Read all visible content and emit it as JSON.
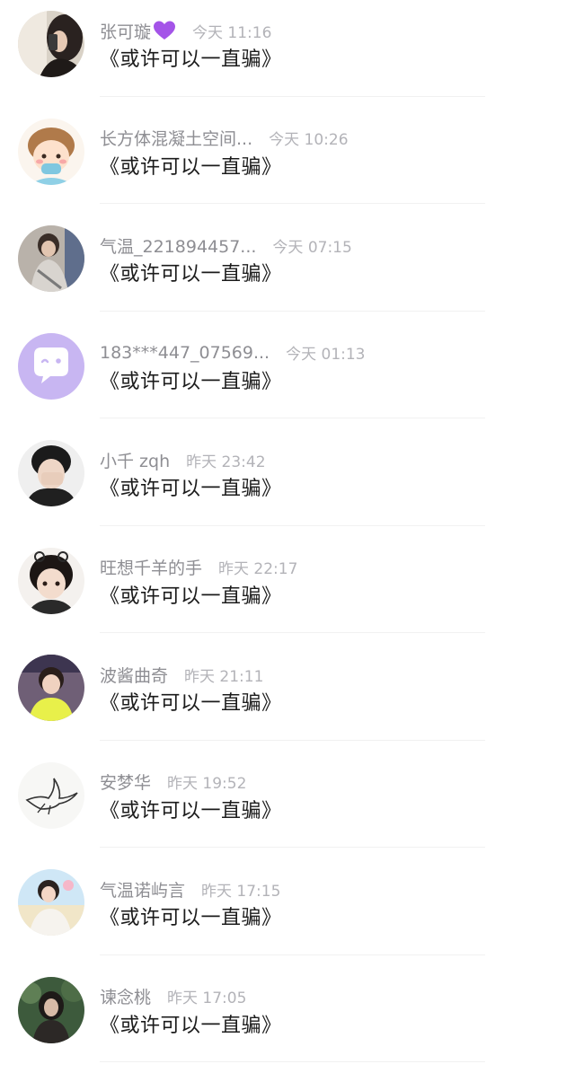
{
  "comments": [
    {
      "name": "张可璇",
      "badge": "purple-heart-icon",
      "time": "今天 11:16",
      "text": "《或许可以一直骗》",
      "avatar": "avatar-photo-icon"
    },
    {
      "name": "长方体混凝土空间...",
      "time": "今天 10:26",
      "text": "《或许可以一直骗》",
      "avatar": "avatar-cartoon-boy-icon"
    },
    {
      "name": "气温_221894457...",
      "time": "今天 07:15",
      "text": "《或许可以一直骗》",
      "avatar": "avatar-photo-icon"
    },
    {
      "name": "183***447_07569...",
      "time": "今天 01:13",
      "text": "《或许可以一直骗》",
      "avatar": "avatar-default-chat-icon"
    },
    {
      "name": "小千 zqh",
      "time": "昨天 23:42",
      "text": "《或许可以一直骗》",
      "avatar": "avatar-photo-icon"
    },
    {
      "name": "旺想千羊的手",
      "time": "昨天 22:17",
      "text": "《或许可以一直骗》",
      "avatar": "avatar-photo-icon"
    },
    {
      "name": "波酱曲奇",
      "time": "昨天 21:11",
      "text": "《或许可以一直骗》",
      "avatar": "avatar-photo-icon"
    },
    {
      "name": "安梦华",
      "time": "昨天 19:52",
      "text": "《或许可以一直骗》",
      "avatar": "avatar-bird-sketch-icon"
    },
    {
      "name": "气温诺屿言",
      "time": "昨天 17:15",
      "text": "《或许可以一直骗》",
      "avatar": "avatar-photo-icon"
    },
    {
      "name": "谏念桃",
      "time": "昨天 17:05",
      "text": "《或许可以一直骗》",
      "avatar": "avatar-photo-icon"
    }
  ],
  "colors": {
    "name": "#8e8e93",
    "time": "#b3b3b8",
    "message": "#1b1b1b",
    "heart": "#a454e8",
    "default_avatar_bg": "#c8b6f2"
  }
}
